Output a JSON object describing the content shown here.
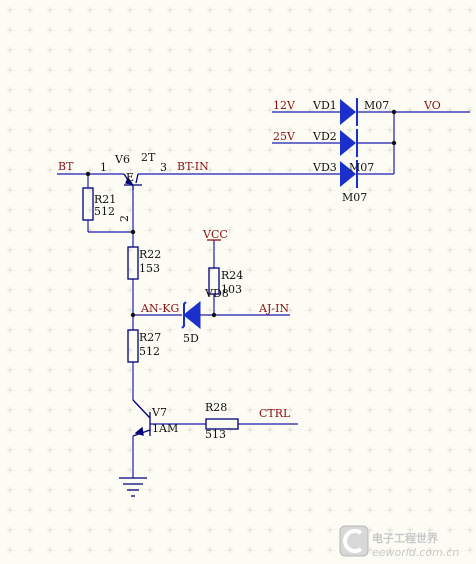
{
  "colors": {
    "wire": "#1c1cb4",
    "label_red": "#8a1010",
    "component": "#00007a",
    "diode_fill": "#1a2fcc",
    "grid": "#d8d8cc",
    "background": "#fcfcf4",
    "junction": "#111111"
  },
  "nets": {
    "bt": "BT",
    "bt_in": "BT-IN",
    "vcc": "VCC",
    "an_kg": "AN-KG",
    "aj_in": "AJ-IN",
    "ctrl": "CTRL",
    "v12": "12V",
    "v25": "25V",
    "vo": "VO"
  },
  "components": {
    "v6": {
      "ref": "V6",
      "value": "2T",
      "emitter_mark": "E",
      "pin1": "1",
      "pin2": "2",
      "pin3": "3"
    },
    "r21": {
      "ref": "R21",
      "value": "512"
    },
    "r22": {
      "ref": "R22",
      "value": "153"
    },
    "r24": {
      "ref": "R24",
      "value": "103"
    },
    "r27": {
      "ref": "R27",
      "value": "512"
    },
    "r28": {
      "ref": "R28",
      "value": "513"
    },
    "vd8": {
      "ref": "VD8",
      "value": "5D"
    },
    "v7": {
      "ref": "V7",
      "value": "1AM"
    },
    "vd1": {
      "ref": "VD1",
      "value": "M07"
    },
    "vd2": {
      "ref": "VD2"
    },
    "vd3": {
      "ref": "VD3",
      "value": "M07",
      "value_below": "M07"
    }
  },
  "watermark": {
    "title": "电子工程世界",
    "url": "eeworld.com.cn",
    "logo_icon": "eeworld-logo-icon"
  }
}
